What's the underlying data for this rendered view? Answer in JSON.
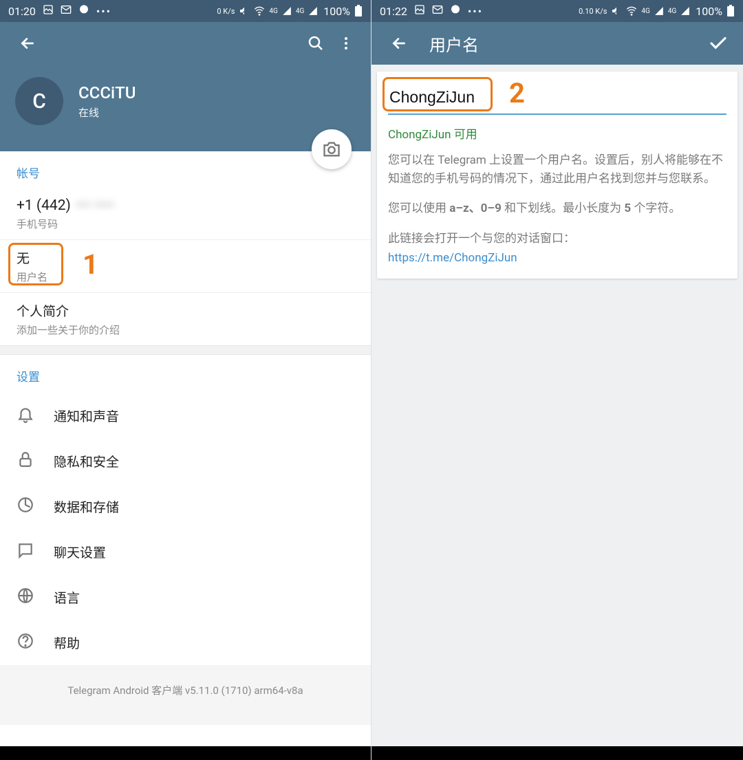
{
  "annotations": {
    "num1": "1",
    "num2": "2"
  },
  "left": {
    "status": {
      "time": "01:20",
      "net_speed": "0 K/s",
      "signal1": "4G",
      "signal2": "4G",
      "battery_pct": "100%"
    },
    "profile": {
      "avatar_letter": "C",
      "name": "CCCiTU",
      "status": "在线"
    },
    "account": {
      "header": "帐号",
      "phone_prefix": "+1 (442)",
      "phone_hidden": "••• ••••",
      "phone_caption": "手机号码",
      "username_value": "无",
      "username_caption": "用户名",
      "bio_label": "个人简介",
      "bio_caption": "添加一些关于你的介绍"
    },
    "settings": {
      "header": "设置",
      "items": [
        {
          "key": "notifications",
          "label": "通知和声音"
        },
        {
          "key": "privacy",
          "label": "隐私和安全"
        },
        {
          "key": "data",
          "label": "数据和存储"
        },
        {
          "key": "chat",
          "label": "聊天设置"
        },
        {
          "key": "language",
          "label": "语言"
        },
        {
          "key": "help",
          "label": "帮助"
        }
      ]
    },
    "footer": "Telegram Android 客户端 v5.11.0 (1710) arm64-v8a"
  },
  "right": {
    "status": {
      "time": "01:22",
      "net_speed": "0.10 K/s",
      "signal1": "4G",
      "signal2": "4G",
      "battery_pct": "100%"
    },
    "title": "用户名",
    "username_value": "ChongZiJun",
    "availability": "ChongZiJun 可用",
    "info1": "您可以在 Telegram 上设置一个用户名。设置后，别人将能够在不知道您的手机号码的情况下，通过此用户名找到您并与您联系。",
    "info2_prefix": "您可以使用 ",
    "info2_rules": "a–z、0–9",
    "info2_mid": " 和下划线。最小长度为 ",
    "info2_len": "5",
    "info2_suffix": " 个字符。",
    "info3": "此链接会打开一个与您的对话窗口：",
    "link": "https://t.me/ChongZiJun"
  }
}
